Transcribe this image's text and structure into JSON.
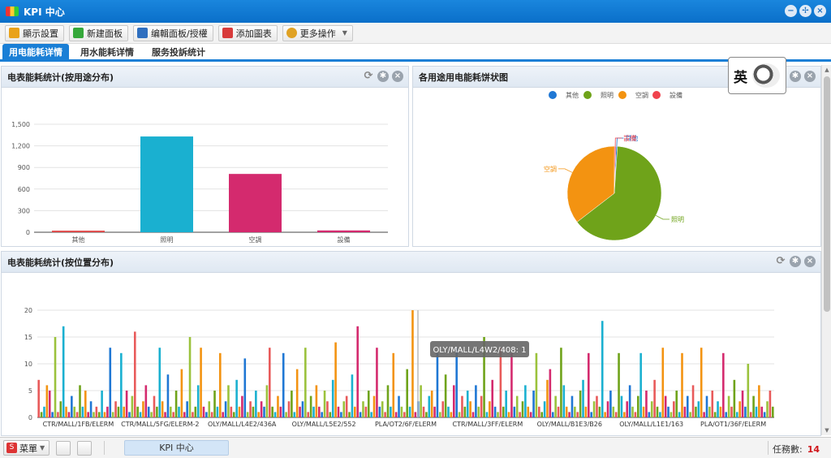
{
  "window": {
    "title": "KPI 中心",
    "buttons": [
      "−",
      "✢",
      "×"
    ]
  },
  "toolbar": {
    "buttons": [
      {
        "label": "顯示設置",
        "icon": "display-settings-icon",
        "color": "#e9a21a"
      },
      {
        "label": "新建面板",
        "icon": "new-panel-icon",
        "color": "#35a83a"
      },
      {
        "label": "编輯面板/授權",
        "icon": "edit-panel-icon",
        "color": "#2f6fbf"
      },
      {
        "label": "添加圖表",
        "icon": "add-chart-icon",
        "color": "#d83b3b"
      },
      {
        "label": "更多操作",
        "icon": "more-actions-icon",
        "color": "#e0a224"
      }
    ]
  },
  "tabs": [
    {
      "label": "用电能耗详情",
      "active": true
    },
    {
      "label": "用水能耗详情",
      "active": false
    },
    {
      "label": "服务投訴统计",
      "active": false
    }
  ],
  "panels": {
    "bar": {
      "title": "电表能耗统计(按用途分布)"
    },
    "pie": {
      "title": "各用途用电能耗饼状图"
    },
    "location": {
      "title": "电表能耗统计(按位置分布)"
    }
  },
  "badge": {
    "text": "英"
  },
  "chart_data": [
    {
      "type": "bar",
      "categories": [
        "其他",
        "照明",
        "空調",
        "設備"
      ],
      "values": [
        5,
        1330,
        810,
        25
      ],
      "colors": [
        "#e05050",
        "#1ab0d0",
        "#d42a6e",
        "#d42a6e"
      ],
      "ylim": [
        0,
        1500
      ],
      "yticks": [
        0,
        300,
        600,
        900,
        1200,
        1500
      ],
      "ytick_labels": [
        "0",
        "300",
        "600",
        "900",
        "1,200",
        "1,500"
      ],
      "grid": true
    },
    {
      "type": "pie",
      "legend": [
        "其他",
        "照明",
        "空調",
        "設備"
      ],
      "legend_colors": [
        "#1f77d4",
        "#6fa31a",
        "#f39311",
        "#f0434d"
      ],
      "legend_position": "top",
      "values": [
        0.5,
        63.5,
        35.5,
        0.5
      ],
      "labels": [
        "其他",
        "照明",
        "空調",
        "設備"
      ]
    },
    {
      "type": "bar",
      "x_tick_labels": [
        "CTR/MALL/1FB/ELERM",
        "CTR/MALL/5FG/ELERM-2",
        "OLY/MALL/L4E2/436A",
        "OLY/MALL/L5E2/552",
        "PLA/OT2/6F/ELERM",
        "CTR/MALL/3FF/ELERM",
        "OLY/MALL/B1E3/B26",
        "OLY/MALL/L1E1/163",
        "PLA/OT1/36F/ELERM"
      ],
      "ylim": [
        0,
        20
      ],
      "yticks": [
        0,
        5,
        10,
        15,
        20
      ],
      "tooltip": "OLY/MALL/L4W2/408: 1",
      "colors": [
        "#e85a5a",
        "#6fa31a",
        "#1ab0d0",
        "#f39311",
        "#d42a6e",
        "#1f77d4",
        "#9bc23c"
      ],
      "values": [
        7,
        1,
        2,
        6,
        5,
        1,
        15,
        1,
        3,
        17,
        2,
        1,
        4,
        2,
        1,
        6,
        2,
        5,
        1,
        3,
        1,
        2,
        1,
        5,
        1,
        2,
        13,
        1,
        3,
        2,
        12,
        2,
        5,
        1,
        4,
        16,
        2,
        1,
        3,
        6,
        2,
        1,
        4,
        2,
        13,
        3,
        1,
        8,
        2,
        1,
        5,
        2,
        9,
        1,
        3,
        15,
        1,
        2,
        6,
        13,
        2,
        1,
        3,
        1,
        5,
        2,
        12,
        1,
        3,
        6,
        2,
        1,
        7,
        2,
        4,
        11,
        1,
        3,
        2,
        5,
        1,
        3,
        2,
        6,
        13,
        2,
        1,
        4,
        2,
        12,
        1,
        3,
        5,
        1,
        9,
        2,
        3,
        13,
        1,
        4,
        2,
        6,
        2,
        1,
        5,
        3,
        1,
        7,
        14,
        2,
        1,
        3,
        4,
        1,
        8,
        2,
        17,
        1,
        3,
        2,
        5,
        1,
        4,
        13,
        2,
        3,
        1,
        6,
        2,
        12,
        1,
        4,
        2,
        1,
        9,
        2,
        20,
        1,
        3,
        6,
        2,
        1,
        4,
        5,
        2,
        12,
        1,
        3,
        8,
        2,
        1,
        6,
        13,
        1,
        4,
        2,
        5,
        3,
        1,
        6,
        2,
        4,
        15,
        1,
        3,
        7,
        2,
        1,
        13,
        2,
        5,
        1,
        12,
        2,
        4,
        1,
        3,
        6,
        2,
        1,
        5,
        12,
        2,
        1,
        3,
        7,
        9,
        1,
        4,
        2,
        13,
        6,
        2,
        1,
        4,
        2,
        1,
        5,
        7,
        2,
        12,
        1,
        3,
        4,
        2,
        18,
        1,
        3,
        5,
        2,
        1,
        12,
        4,
        1,
        3,
        6,
        2,
        1,
        4,
        12,
        2,
        5,
        1,
        3,
        7,
        2,
        1,
        13,
        4,
        2,
        1,
        3,
        5,
        1,
        12,
        2,
        4,
        1,
        6,
        2,
        3,
        13,
        1,
        4,
        2,
        5,
        1,
        3,
        2,
        12,
        1,
        4,
        2,
        7,
        1,
        3,
        5,
        2,
        10,
        1,
        4,
        2,
        6,
        2,
        1,
        3,
        5,
        2
      ]
    }
  ],
  "taskbar": {
    "menu_label": "菜單",
    "task_item": "KPI 中心",
    "count_label": "任務數:",
    "count_value": "14"
  }
}
